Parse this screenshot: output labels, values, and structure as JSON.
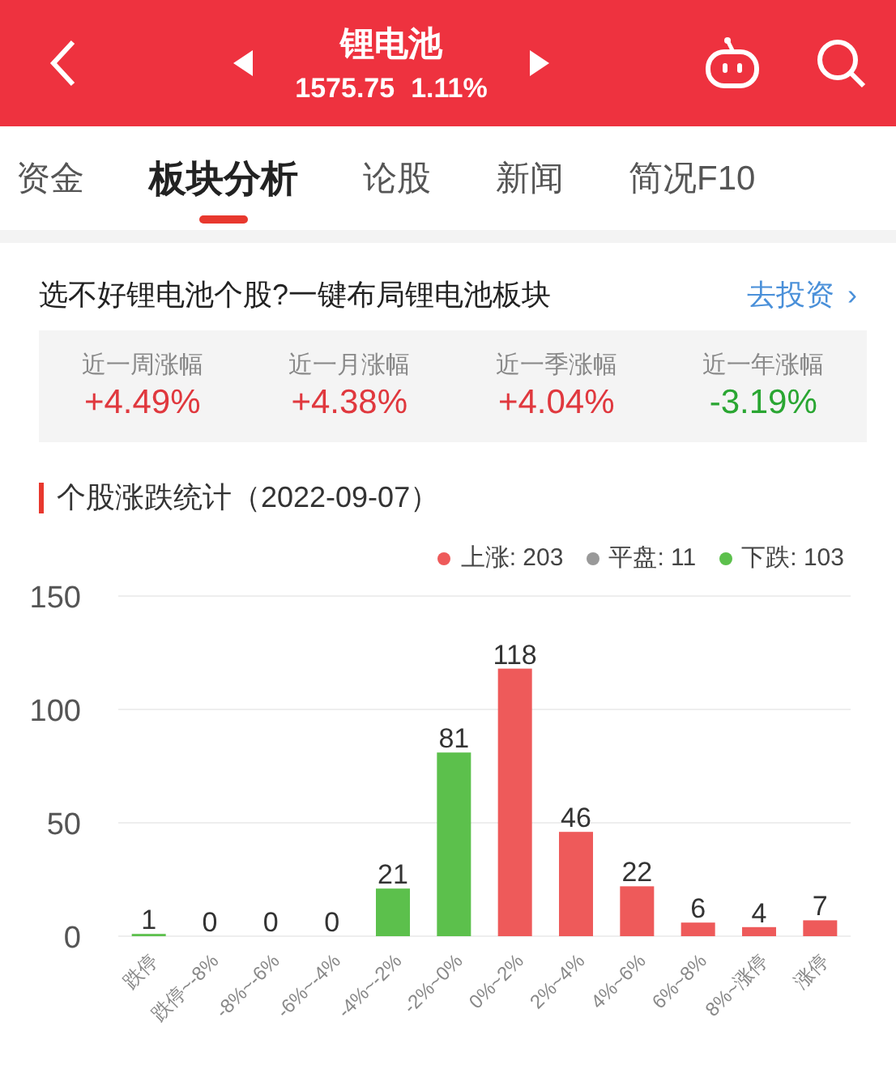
{
  "header": {
    "title": "锂电池",
    "price": "1575.75",
    "change": "1.11%"
  },
  "tabs": [
    {
      "label": "资金",
      "selected": false
    },
    {
      "label": "板块分析",
      "selected": true
    },
    {
      "label": "论股",
      "selected": false
    },
    {
      "label": "新闻",
      "selected": false
    },
    {
      "label": "简况F10",
      "selected": false
    }
  ],
  "banner": {
    "text": "选不好锂电池个股?一键布局锂电池板块",
    "link": "去投资",
    "chevron": "›"
  },
  "stats": [
    {
      "label": "近一周涨幅",
      "value": "+4.49%",
      "color": "#e0383e"
    },
    {
      "label": "近一月涨幅",
      "value": "+4.38%",
      "color": "#e0383e"
    },
    {
      "label": "近一季涨幅",
      "value": "+4.04%",
      "color": "#e0383e"
    },
    {
      "label": "近一年涨幅",
      "value": "-3.19%",
      "color": "#2aa632"
    }
  ],
  "section": {
    "title": "个股涨跌统计（2022-09-07）"
  },
  "legend": [
    {
      "label": "上涨: 203",
      "color": "#ee5a5a"
    },
    {
      "label": "平盘: 11",
      "color": "#999999"
    },
    {
      "label": "下跌: 103",
      "color": "#5cc04c"
    }
  ],
  "chart_data": {
    "type": "bar",
    "stacked": true,
    "data_labels": true,
    "ylim": [
      0,
      150
    ],
    "yticks": [
      0,
      50,
      100,
      150
    ],
    "categories": [
      "跌停",
      "跌停~-8%",
      "-8%~-6%",
      "-6%~-4%",
      "-4%~-2%",
      "-2%~0%",
      "0%~2%",
      "2%~4%",
      "4%~6%",
      "6%~8%",
      "8%~涨停",
      "涨停"
    ],
    "series": [
      {
        "color": "#5cc04c",
        "values": [
          1,
          0,
          0,
          0,
          21,
          81,
          null,
          null,
          null,
          null,
          null,
          null
        ]
      },
      {
        "color": "#ee5a5a",
        "values": [
          null,
          null,
          null,
          null,
          null,
          null,
          118,
          46,
          22,
          6,
          4,
          7
        ]
      }
    ]
  }
}
